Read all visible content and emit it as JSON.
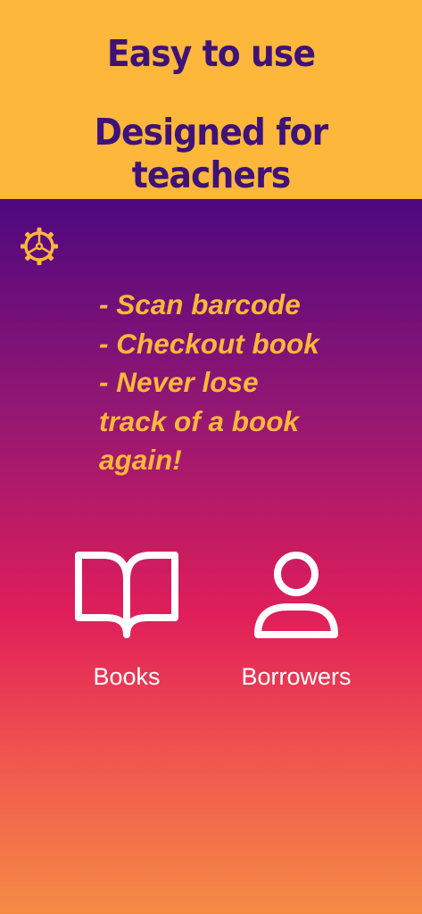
{
  "header": {
    "line1": "Easy to use",
    "line2": "Designed for teachers"
  },
  "settings": {
    "icon": "gear-icon"
  },
  "features": [
    "- Scan barcode",
    "- Checkout book",
    "- Never lose",
    "track of a book",
    "again!"
  ],
  "nav": {
    "books": {
      "label": "Books",
      "icon": "open-book-icon"
    },
    "borrowers": {
      "label": "Borrowers",
      "icon": "person-icon"
    }
  },
  "colors": {
    "banner": "#FDB73B",
    "headline": "#3E1278",
    "accent": "#FDB73B",
    "gradient_top": "#4E0880",
    "gradient_mid": "#E01E5A",
    "gradient_bottom": "#F58C44"
  }
}
